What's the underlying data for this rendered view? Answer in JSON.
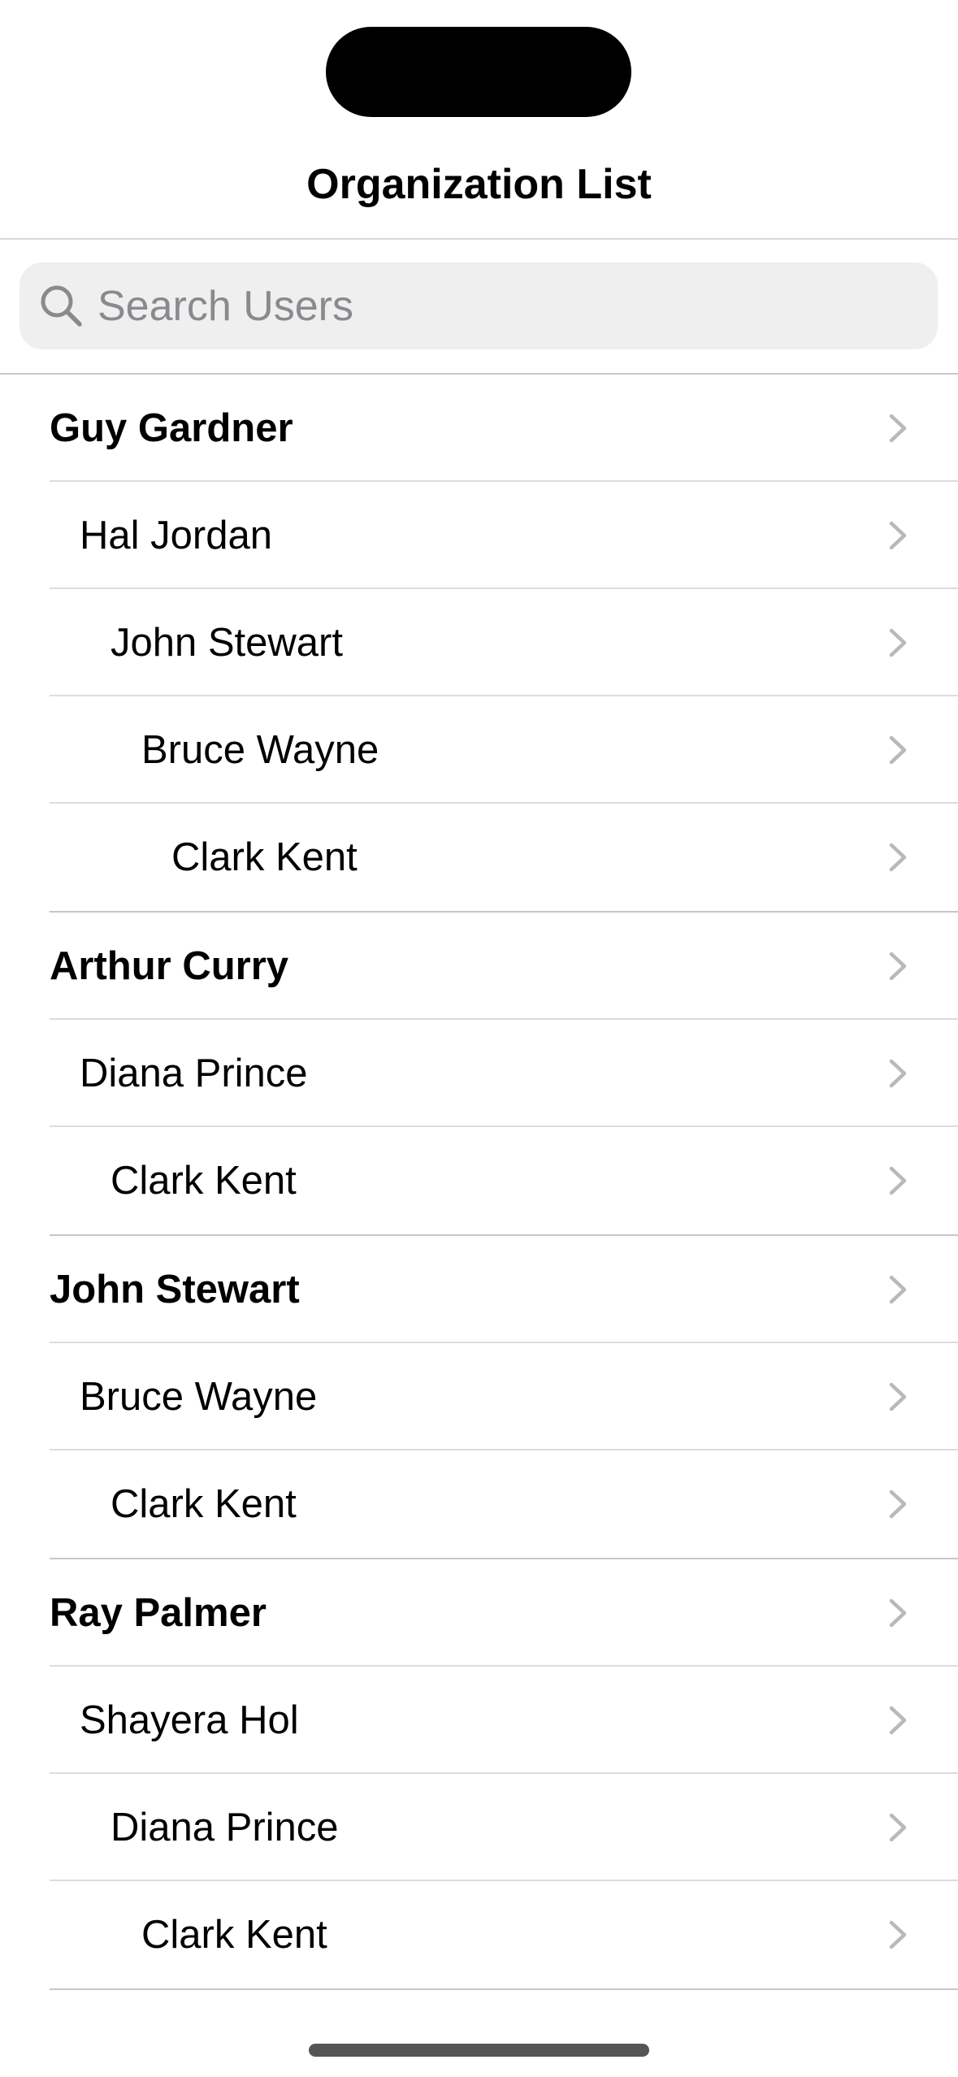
{
  "header": {
    "title": "Organization List"
  },
  "search": {
    "placeholder": "Search Users",
    "value": ""
  },
  "groups": [
    {
      "rows": [
        {
          "label": "Guy Gardner",
          "level": 0
        },
        {
          "label": "Hal Jordan",
          "level": 1
        },
        {
          "label": "John Stewart",
          "level": 2
        },
        {
          "label": "Bruce Wayne",
          "level": 3
        },
        {
          "label": "Clark Kent",
          "level": 4
        }
      ]
    },
    {
      "rows": [
        {
          "label": "Arthur Curry",
          "level": 0
        },
        {
          "label": "Diana Prince",
          "level": 1
        },
        {
          "label": "Clark Kent",
          "level": 2
        }
      ]
    },
    {
      "rows": [
        {
          "label": "John Stewart",
          "level": 0
        },
        {
          "label": "Bruce Wayne",
          "level": 1
        },
        {
          "label": "Clark Kent",
          "level": 2
        }
      ]
    },
    {
      "rows": [
        {
          "label": "Ray Palmer",
          "level": 0
        },
        {
          "label": "Shayera Hol",
          "level": 1
        },
        {
          "label": "Diana Prince",
          "level": 2
        },
        {
          "label": "Clark Kent",
          "level": 3
        }
      ]
    }
  ],
  "icons": {
    "search": "search-icon",
    "row_disclosure": "chevron-right-icon"
  },
  "colors": {
    "background": "#ffffff",
    "search_field": "#efeff0",
    "placeholder": "#8a8a8e",
    "chevron": "#b8b8bd",
    "divider": "#dcdce0"
  }
}
